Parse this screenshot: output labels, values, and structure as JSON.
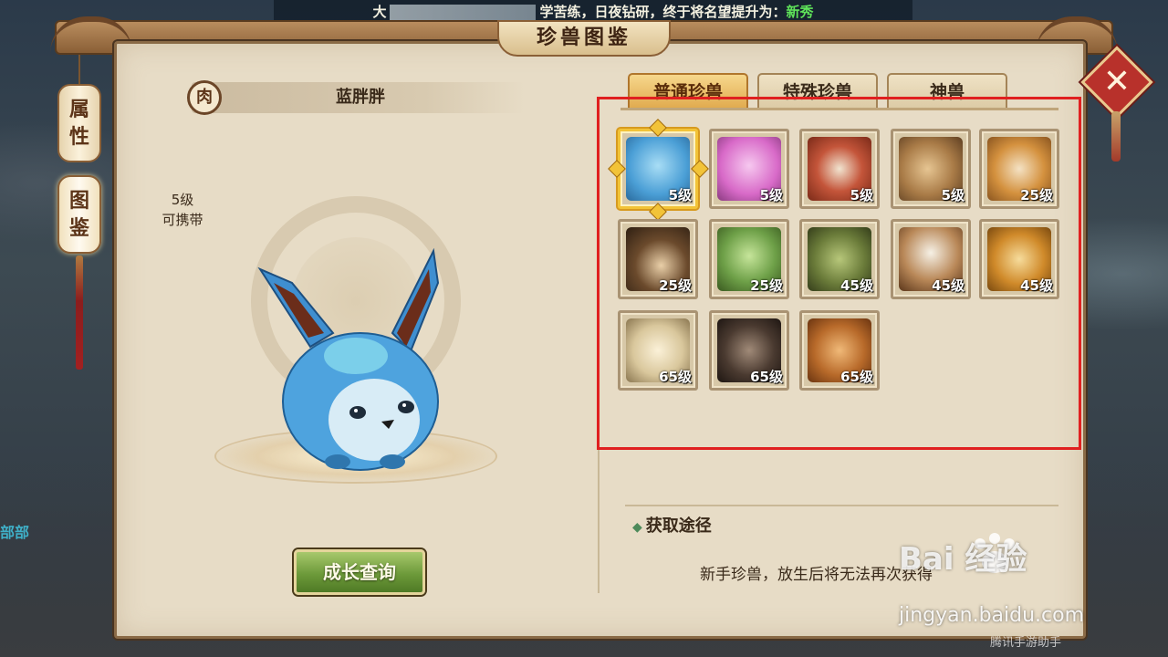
{
  "marquee": {
    "prefix": "大",
    "middle": "学苦练，日夜钻研，终于将名望提升为：",
    "highlight": "新秀"
  },
  "window": {
    "title": "珍兽图鉴"
  },
  "side_tabs": [
    {
      "label_1": "属",
      "label_2": "性"
    },
    {
      "label_1": "图",
      "label_2": "鉴"
    }
  ],
  "pet": {
    "badge": "肉",
    "name": "蓝胖胖",
    "level": "5级",
    "carry": "可携带"
  },
  "growth_button": "成长查询",
  "tabs": [
    "普通珍兽",
    "特殊珍兽",
    "神兽"
  ],
  "grid": [
    {
      "level": "5级",
      "icon": "blue-fox-pet-icon",
      "color": "#5aa8d8"
    },
    {
      "level": "5级",
      "icon": "pink-fox-pet-icon",
      "color": "#d86ac8"
    },
    {
      "level": "5级",
      "icon": "squirrel-pet-icon",
      "color": "#b6452c"
    },
    {
      "level": "5级",
      "icon": "acorn-creature-pet-icon",
      "color": "#a97b47"
    },
    {
      "level": "25级",
      "icon": "ground-squirrel-pet-icon",
      "color": "#c98a3e"
    },
    {
      "level": "25级",
      "icon": "hedgehog-pet-icon",
      "color": "#6b4a2c"
    },
    {
      "level": "25级",
      "icon": "mantis-pet-icon",
      "color": "#6ea048"
    },
    {
      "level": "45级",
      "icon": "lizard-pet-icon",
      "color": "#6b7c3a"
    },
    {
      "level": "45级",
      "icon": "eagle-pet-icon",
      "color": "#8b5a2e"
    },
    {
      "level": "45级",
      "icon": "leopard-pet-icon",
      "color": "#d08a2a"
    },
    {
      "level": "65级",
      "icon": "bear-pet-icon",
      "color": "#d9c79c"
    },
    {
      "level": "65级",
      "icon": "gorilla-pet-icon",
      "color": "#4a3a30"
    },
    {
      "level": "65级",
      "icon": "horse-pet-icon",
      "color": "#b86a2a"
    }
  ],
  "acquisition": {
    "title": "获取途径",
    "description": "新手珍兽，放生后将无法再次获得"
  },
  "background_text": "部部",
  "watermark": {
    "logo": "Bai 经验",
    "url": "jingyan.baidu.com",
    "corner": "腾讯手游助手"
  },
  "colors": {
    "accent_orange": "#e0a94c",
    "highlight_red": "#e02020",
    "marquee_green": "#5fe35a"
  }
}
